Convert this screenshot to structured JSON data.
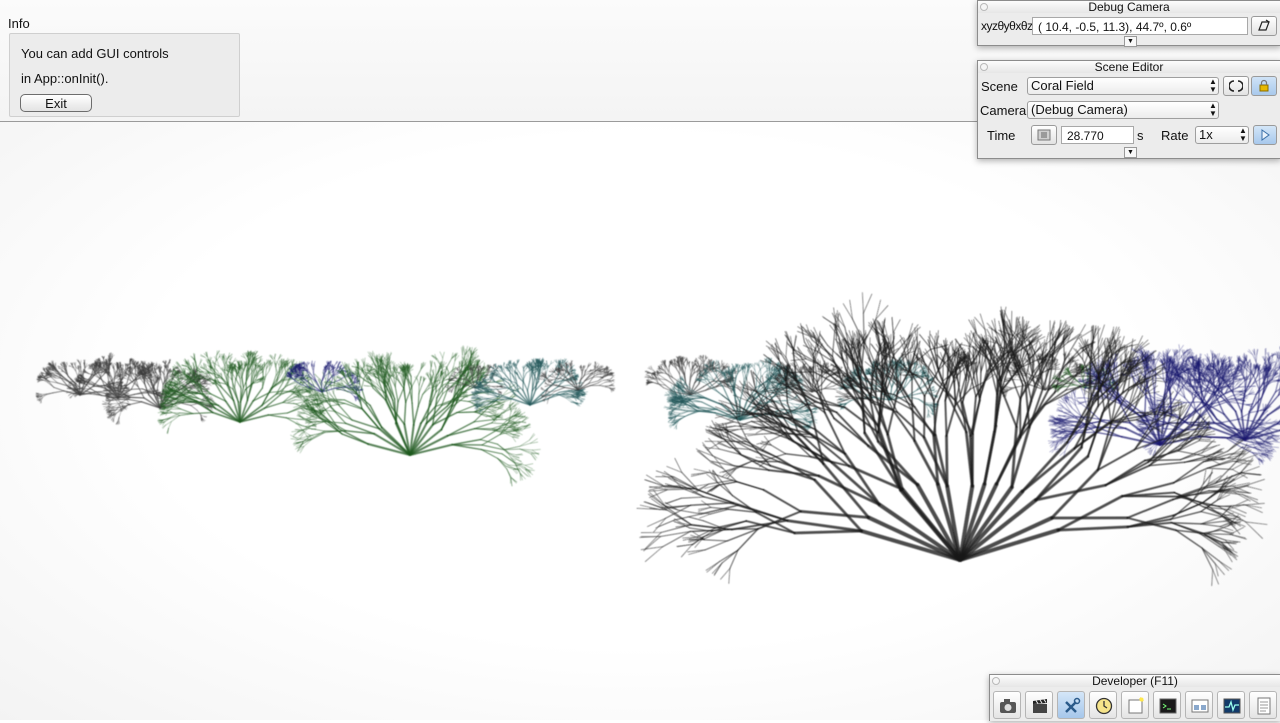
{
  "info": {
    "title": "Info",
    "line1": "You can add GUI controls",
    "line2": "in App::onInit().",
    "exit_label": "Exit"
  },
  "debug_camera": {
    "title": "Debug Camera",
    "label": "xyzθyθxθz",
    "value": "( 10.4,  -0.5,  11.3),  44.7º,   0.6º",
    "copy_icon": "copy-frame-icon"
  },
  "scene_editor": {
    "title": "Scene Editor",
    "scene_label": "Scene",
    "scene_value": "Coral Field",
    "camera_label": "Camera",
    "camera_value": "(Debug Camera)",
    "time_label": "Time",
    "time_value": "28.770",
    "time_unit": "s",
    "rate_label": "Rate",
    "rate_value": "1x",
    "reload_icon": "reload-icon",
    "lock_icon": "lock-icon",
    "play_icon": "play-icon",
    "filmstrip_icon": "filmstrip-icon"
  },
  "developer": {
    "title": "Developer (F11)",
    "buttons": [
      "camera-icon",
      "clapperboard-icon",
      "tools-icon",
      "clock-icon",
      "new-window-icon",
      "terminal-icon",
      "scene-graph-icon",
      "profiler-icon",
      "log-icon"
    ]
  },
  "colors": {
    "coral_black": "#151515",
    "coral_green": "#1f5a1f",
    "coral_teal": "#23585a",
    "coral_blue": "#1b1a6e",
    "coral_gray": "#3c3c3c"
  }
}
